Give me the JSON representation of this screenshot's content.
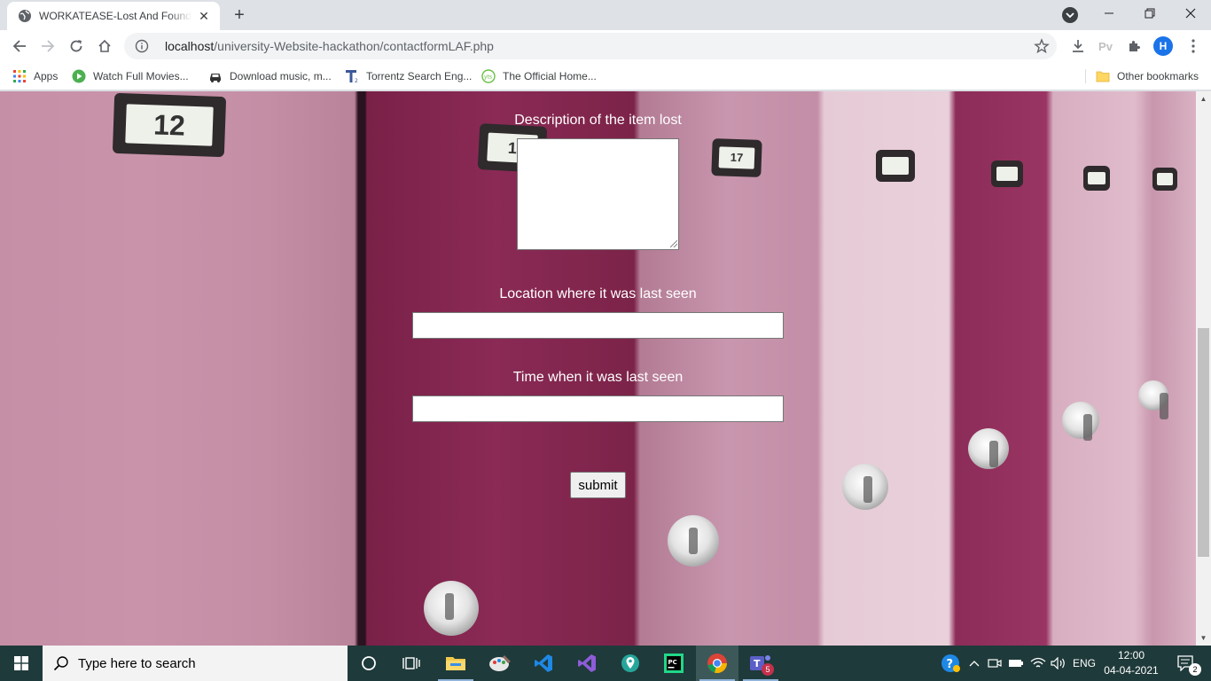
{
  "browser": {
    "tab": {
      "title": "WORKATEASE-Lost And Found/contactformLAF"
    },
    "url": {
      "host": "localhost",
      "path": "/university-Website-hackathon/contactformLAF.php"
    },
    "profile_initial": "H",
    "extension_label": "Pv"
  },
  "bookmarks": {
    "apps": "Apps",
    "items": [
      "Watch Full Movies...",
      "Download music, m...",
      "Torrentz Search Eng...",
      "The Official Home..."
    ],
    "other": "Other bookmarks"
  },
  "page": {
    "lockers": {
      "n12": "12",
      "n1": "1",
      "n17": "17"
    },
    "form": {
      "description_label": "Description of the item lost",
      "description_value": "",
      "location_label": "Location where it was last seen",
      "location_value": "",
      "time_label": "Time when it was last seen",
      "time_value": "",
      "submit_label": "submit"
    }
  },
  "taskbar": {
    "search_placeholder": "Type here to search",
    "teams_badge": "5",
    "language": "ENG",
    "time": "12:00",
    "date": "04-04-2021",
    "notification_count": "2"
  }
}
